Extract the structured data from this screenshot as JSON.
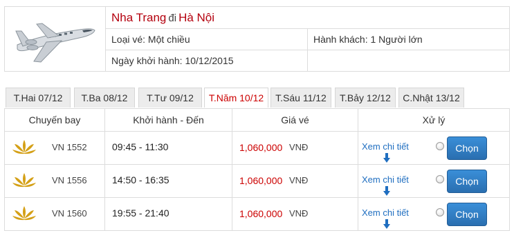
{
  "header": {
    "from_city": "Nha Trang",
    "separator": "đi",
    "to_city": "Hà Nội",
    "ticket_type": "Loại vé: Một chiều",
    "passengers": "Hành khách: 1 Người lớn",
    "departure_date": "Ngày khởi hành: 10/12/2015",
    "icon": "airplane-icon"
  },
  "tabs": [
    {
      "label": "T.Hai 07/12",
      "active": false
    },
    {
      "label": "T.Ba 08/12",
      "active": false
    },
    {
      "label": "T.Tư 09/12",
      "active": false
    },
    {
      "label": "T.Năm 10/12",
      "active": true
    },
    {
      "label": "T.Sáu 11/12",
      "active": false
    },
    {
      "label": "T.Bảy 12/12",
      "active": false
    },
    {
      "label": "C.Nhật 13/12",
      "active": false
    }
  ],
  "table": {
    "headers": {
      "flight": "Chuyến bay",
      "time": "Khởi hành - Đến",
      "price": "Giá vé",
      "action": "Xử lý"
    },
    "rows": [
      {
        "flight_no": "VN 1552",
        "times": "09:45 - 11:30",
        "price": "1,060,000",
        "currency": "VNĐ",
        "detail": "Xem chi tiết",
        "select": "Chọn"
      },
      {
        "flight_no": "VN 1556",
        "times": "14:50 - 16:35",
        "price": "1,060,000",
        "currency": "VNĐ",
        "detail": "Xem chi tiết",
        "select": "Chọn"
      },
      {
        "flight_no": "VN 1560",
        "times": "19:55 - 21:40",
        "price": "1,060,000",
        "currency": "VNĐ",
        "detail": "Xem chi tiết",
        "select": "Chọn"
      }
    ],
    "airline_logo_icon": "lotus-logo-icon"
  },
  "colors": {
    "city": "#b4000e",
    "active_tab": "#cc0000",
    "price": "#cc0000",
    "link": "#1f6ec0",
    "button": "#2a6fb0",
    "logo_gold": "#d4a017"
  }
}
